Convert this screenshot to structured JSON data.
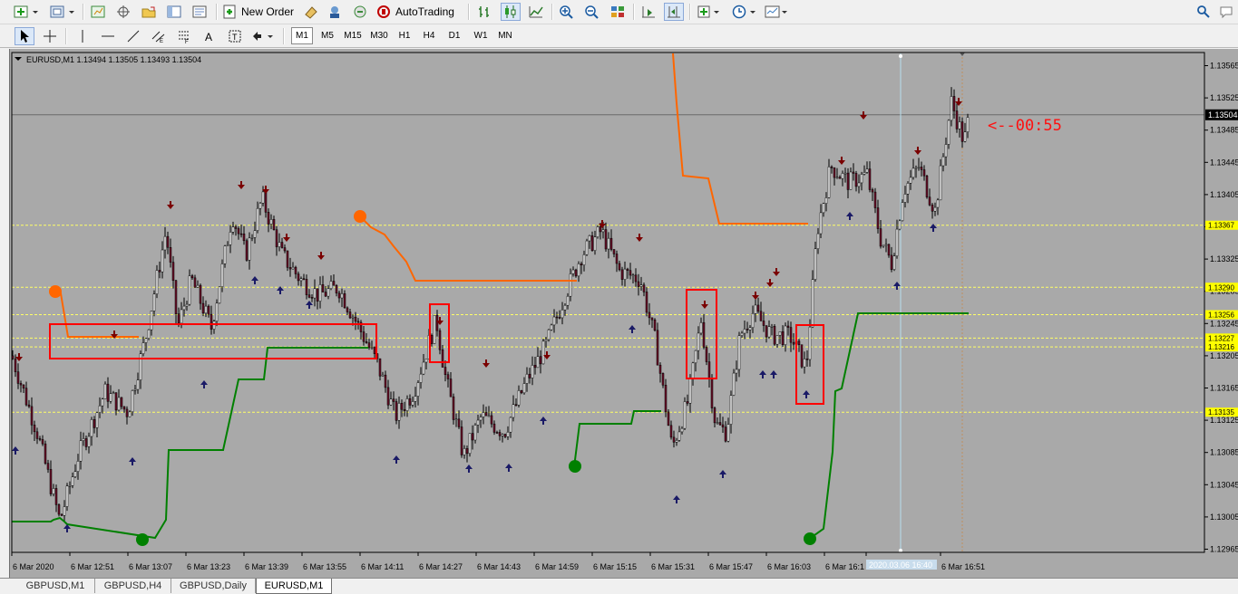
{
  "toolbar": {
    "new_order_label": "New Order",
    "autotrading_label": "AutoTrading"
  },
  "timeframes": [
    "M1",
    "M5",
    "M15",
    "M30",
    "H1",
    "H4",
    "D1",
    "W1",
    "MN"
  ],
  "active_timeframe": "M1",
  "chart": {
    "header": "EURUSD,M1  1.13494 1.13505 1.13493 1.13504",
    "countdown": "<--00:55",
    "price_labels": [
      "1.13565",
      "1.13525",
      "1.13485",
      "1.13445",
      "1.13405",
      "1.13365",
      "1.13325",
      "1.13285",
      "1.13245",
      "1.13205",
      "1.13165",
      "1.13125",
      "1.13085",
      "1.13045",
      "1.13005",
      "1.12965"
    ],
    "current_price": "1.13504",
    "level_tags": [
      "1.13367",
      "1.13290",
      "1.13256",
      "1.13227",
      "1.13216",
      "1.13135"
    ],
    "time_labels": [
      "6 Mar 2020",
      "6 Mar 12:51",
      "6 Mar 13:07",
      "6 Mar 13:23",
      "6 Mar 13:39",
      "6 Mar 13:55",
      "6 Mar 14:11",
      "6 Mar 14:27",
      "6 Mar 14:43",
      "6 Mar 14:59",
      "6 Mar 15:15",
      "6 Mar 15:31",
      "6 Mar 15:47",
      "6 Mar 16:03",
      "6 Mar 16:1",
      "2020.03.06 16:40",
      "6 Mar 16:51"
    ],
    "colors": {
      "background": "#a9a9a9",
      "bull": "#ffffff",
      "bear": "#6b0f28",
      "level": "#ffff66",
      "buy_arrow": "#1a1a66",
      "sell_arrow": "#7a0000",
      "green_line": "#008000",
      "orange_line": "#ff6600",
      "box": "#ff0000"
    }
  },
  "tabs": [
    "GBPUSD,M1",
    "GBPUSD,H4",
    "GBPUSD,Daily",
    "EURUSD,M1"
  ],
  "active_tab": "EURUSD,M1"
}
